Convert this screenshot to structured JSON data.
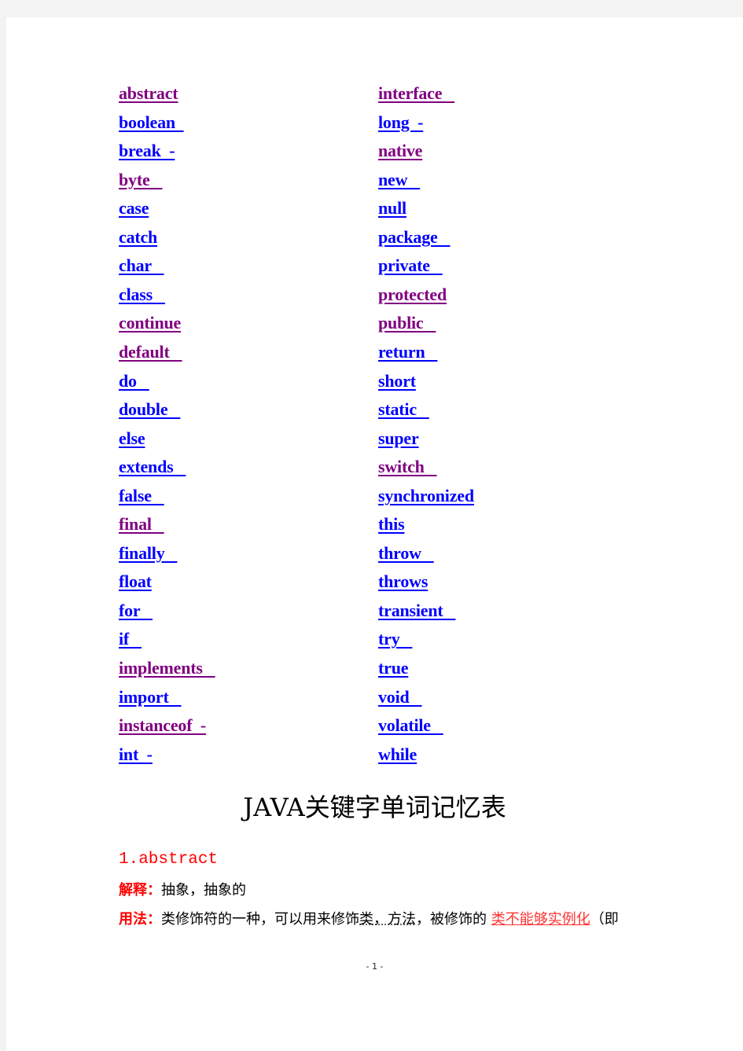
{
  "colors": {
    "link_blue": "#0000ff",
    "link_visited_purple": "#800080",
    "accent_red": "#ff0000",
    "page_bg": "#ffffff",
    "viewer_bg": "#f3f3f3"
  },
  "keywords": {
    "left": [
      {
        "text": "abstract",
        "color": "purple"
      },
      {
        "text": "boolean  ",
        "color": "blue"
      },
      {
        "text": "break  -",
        "color": "blue"
      },
      {
        "text": "byte   ",
        "color": "purple"
      },
      {
        "text": "case",
        "color": "blue"
      },
      {
        "text": "catch",
        "color": "blue"
      },
      {
        "text": "char   ",
        "color": "blue"
      },
      {
        "text": "class   ",
        "color": "blue"
      },
      {
        "text": "continue",
        "color": "purple"
      },
      {
        "text": "default   ",
        "color": "purple"
      },
      {
        "text": "do   ",
        "color": "blue"
      },
      {
        "text": "double   ",
        "color": "blue"
      },
      {
        "text": "else",
        "color": "blue"
      },
      {
        "text": "extends   ",
        "color": "blue"
      },
      {
        "text": "false   ",
        "color": "blue"
      },
      {
        "text": "final   ",
        "color": "purple"
      },
      {
        "text": "finally   ",
        "color": "blue"
      },
      {
        "text": "float",
        "color": "blue"
      },
      {
        "text": "for   ",
        "color": "blue"
      },
      {
        "text": "if   ",
        "color": "blue"
      },
      {
        "text": "implements   ",
        "color": "purple"
      },
      {
        "text": "import   ",
        "color": "blue"
      },
      {
        "text": "instanceof  -",
        "color": "purple"
      },
      {
        "text": "int  -",
        "color": "blue"
      }
    ],
    "right": [
      {
        "text": "interface   ",
        "color": "purple"
      },
      {
        "text": "long  -",
        "color": "blue"
      },
      {
        "text": "native",
        "color": "purple"
      },
      {
        "text": "new   ",
        "color": "blue"
      },
      {
        "text": "null",
        "color": "blue"
      },
      {
        "text": "package   ",
        "color": "blue"
      },
      {
        "text": "private   ",
        "color": "blue"
      },
      {
        "text": "protected",
        "color": "purple"
      },
      {
        "text": "public   ",
        "color": "purple"
      },
      {
        "text": "return   ",
        "color": "blue"
      },
      {
        "text": "short",
        "color": "blue"
      },
      {
        "text": "static   ",
        "color": "blue"
      },
      {
        "text": "super",
        "color": "blue"
      },
      {
        "text": "switch   ",
        "color": "purple"
      },
      {
        "text": "synchronized",
        "color": "blue"
      },
      {
        "text": "this",
        "color": "blue"
      },
      {
        "text": "throw   ",
        "color": "blue"
      },
      {
        "text": "throws",
        "color": "blue"
      },
      {
        "text": "transient   ",
        "color": "blue"
      },
      {
        "text": "try   ",
        "color": "blue"
      },
      {
        "text": "true",
        "color": "blue"
      },
      {
        "text": "void   ",
        "color": "blue"
      },
      {
        "text": "volatile   ",
        "color": "blue"
      },
      {
        "text": "while",
        "color": "blue"
      }
    ]
  },
  "document": {
    "title": "JAVA关键字单词记忆表",
    "section_1": {
      "heading": "1.abstract",
      "explanation_label": "解释：",
      "explanation_text": "抽象，抽象的",
      "usage_label": "用法：",
      "usage_text_1": "类修饰符的一种，可以用来修饰",
      "usage_text_underlined": "类，方法",
      "usage_text_2": "，被修饰的 ",
      "usage_text_red": "类不能够实例化",
      "usage_text_3": "（即"
    },
    "page_number": "- 1 -"
  }
}
